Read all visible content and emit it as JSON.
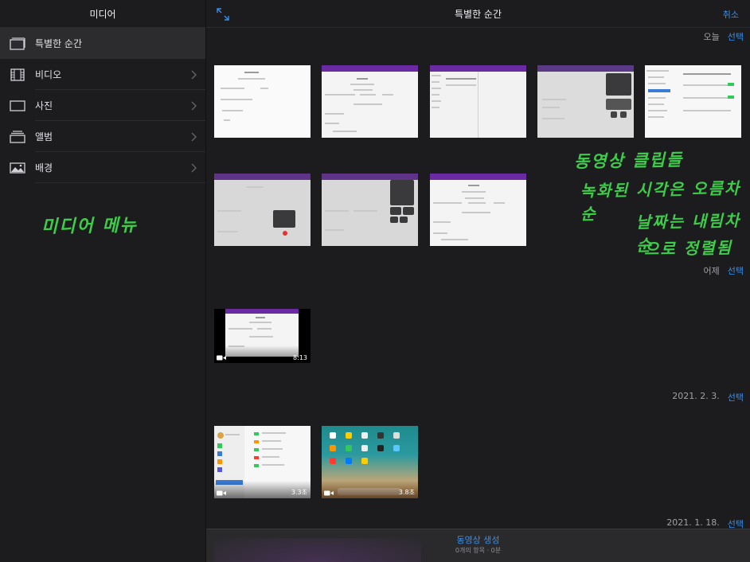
{
  "sidebar": {
    "title": "미디어",
    "items": [
      {
        "label": "특별한 순간",
        "icon": "moments-icon"
      },
      {
        "label": "비디오",
        "icon": "film-strip-icon"
      },
      {
        "label": "사진",
        "icon": "photo-frame-icon"
      },
      {
        "label": "앨범",
        "icon": "album-stack-icon"
      },
      {
        "label": "배경",
        "icon": "landscape-image-icon"
      }
    ],
    "annotation": "미디어 메뉴"
  },
  "main": {
    "title": "특별한 순간",
    "cancel_label": "취소",
    "annotation_lines": [
      "동영상 클립들",
      "녹화된 시각은 오름차순",
      "날짜는 내림차순",
      "으로 정렬됨"
    ],
    "sections": [
      {
        "date": "오늘",
        "select_label": "선택"
      },
      {
        "date": "어제",
        "select_label": "선택"
      },
      {
        "date": "2021. 2. 3.",
        "select_label": "선택"
      },
      {
        "date": "2021. 1. 18.",
        "select_label": "선택"
      }
    ],
    "videos": {
      "yesterday_1": {
        "duration": "8:13"
      },
      "feb3_1": {
        "duration": "3.3초"
      },
      "feb3_2": {
        "duration": "3.8초"
      }
    }
  },
  "bottom": {
    "create_label": "동영상 생성",
    "summary": "0개의 항목 · 0분"
  },
  "colors": {
    "accent": "#3a8ee6",
    "annotation": "#3ecc4a",
    "purple_bar": "#6a2aa1"
  }
}
